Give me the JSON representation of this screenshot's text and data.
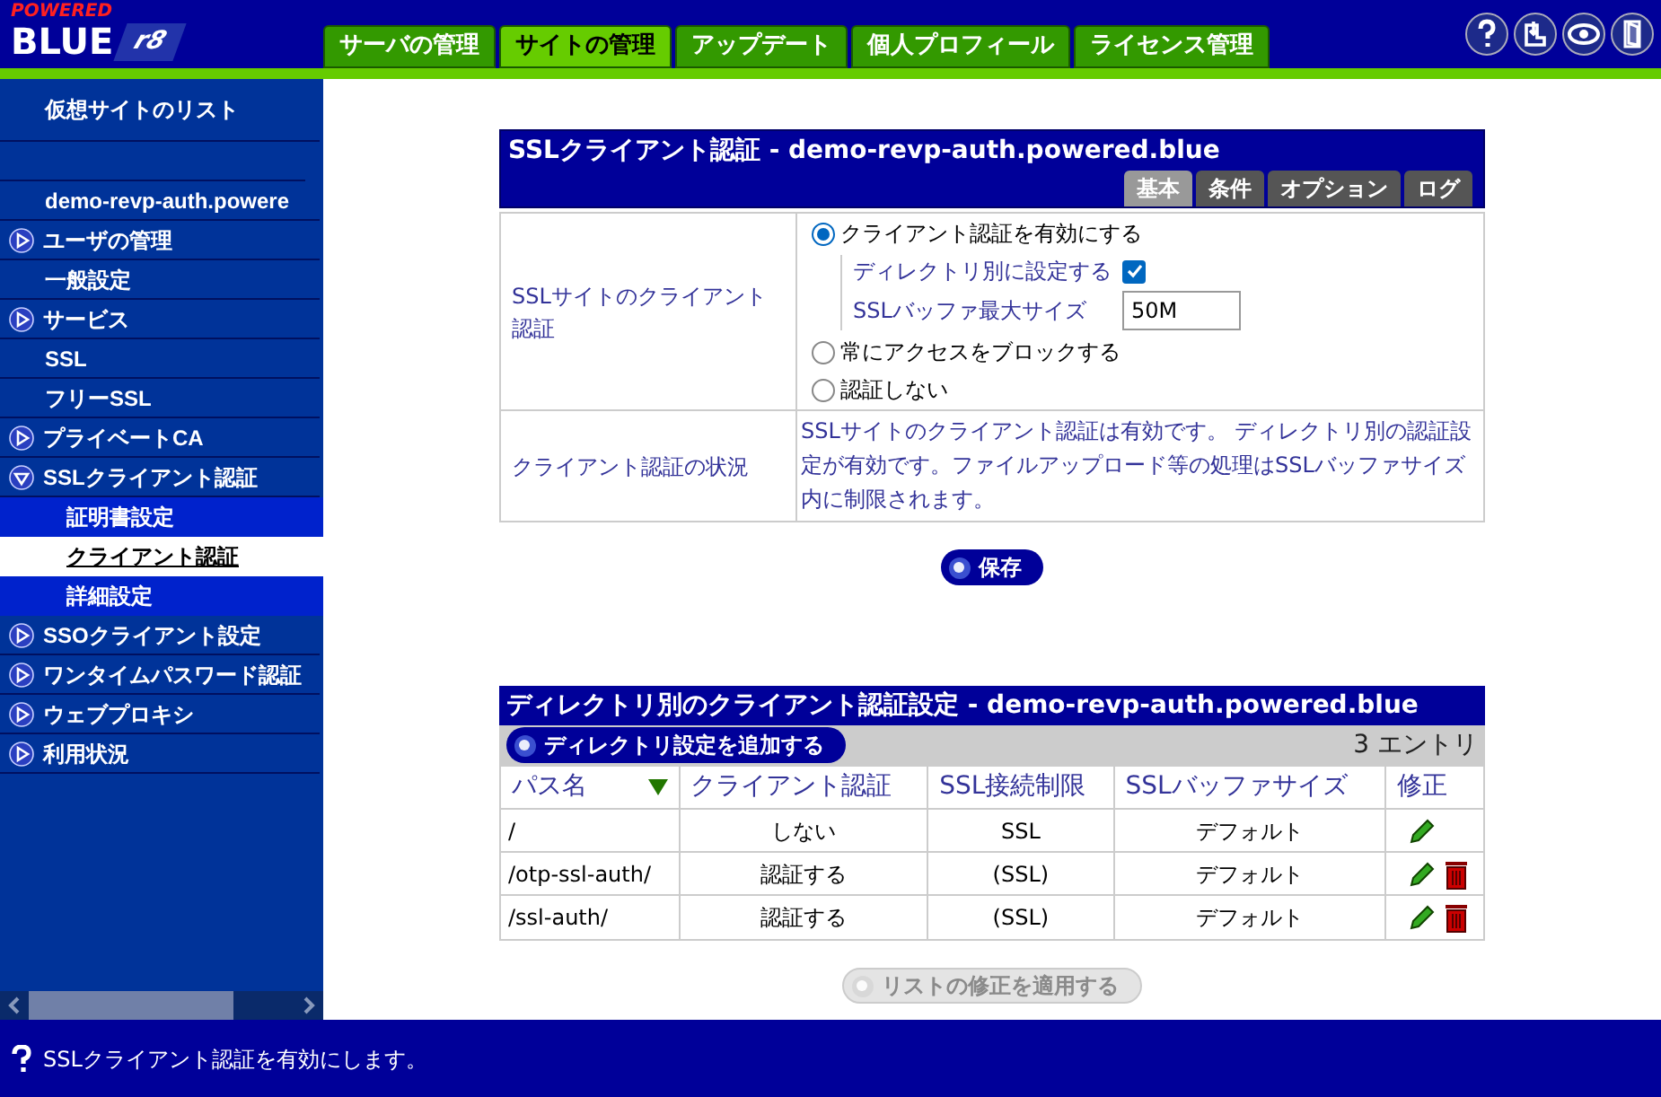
{
  "logo": {
    "top": "POWERED",
    "main": "BLUE",
    "version": "r8"
  },
  "tabs": [
    {
      "label": "サーバの管理",
      "selected": false
    },
    {
      "label": "サイトの管理",
      "selected": true
    },
    {
      "label": "アップデート",
      "selected": false
    },
    {
      "label": "個人プロフィール",
      "selected": false
    },
    {
      "label": "ライセンス管理",
      "selected": false
    }
  ],
  "sidebar": {
    "items": [
      {
        "label": "仮想サイトのリスト",
        "kind": "heading"
      },
      {
        "label": "demo-revp-auth.powere",
        "kind": "link"
      },
      {
        "label": "ユーザの管理",
        "kind": "group",
        "expanded": false
      },
      {
        "label": "一般設定",
        "kind": "link"
      },
      {
        "label": "サービス",
        "kind": "group",
        "expanded": false
      },
      {
        "label": "SSL",
        "kind": "link"
      },
      {
        "label": "フリーSSL",
        "kind": "link"
      },
      {
        "label": "プライベートCA",
        "kind": "group",
        "expanded": false
      },
      {
        "label": "SSLクライアント認証",
        "kind": "group",
        "expanded": true,
        "children": [
          {
            "label": "証明書設定",
            "selected": false
          },
          {
            "label": "クライアント認証",
            "selected": true
          },
          {
            "label": "詳細設定",
            "selected": false
          }
        ]
      },
      {
        "label": "SSOクライアント設定",
        "kind": "group",
        "expanded": false
      },
      {
        "label": "ワンタイムパスワード認証",
        "kind": "group",
        "expanded": false
      },
      {
        "label": "ウェブプロキシ",
        "kind": "group",
        "expanded": false
      },
      {
        "label": "利用状況",
        "kind": "group",
        "expanded": false
      }
    ]
  },
  "settings_panel": {
    "title": "SSLクライアント認証 - demo-revp-auth.powered.blue",
    "tabs": [
      {
        "label": "基本",
        "selected": true
      },
      {
        "label": "条件",
        "selected": false
      },
      {
        "label": "オプション",
        "selected": false
      },
      {
        "label": "ログ",
        "selected": false
      }
    ],
    "mode": {
      "label": "SSLサイトのクライアント認証",
      "options": [
        {
          "label": "クライアント認証を有効にする",
          "selected": true
        },
        {
          "label": "常にアクセスをブロックする",
          "selected": false
        },
        {
          "label": "認証しない",
          "selected": false
        }
      ],
      "per_directory": {
        "label": "ディレクトリ別に設定する",
        "checked": true
      },
      "buffer": {
        "label": "SSLバッファ最大サイズ",
        "value": "50M"
      }
    },
    "status": {
      "label": "クライアント認証の状況",
      "text": "SSLサイトのクライアント認証は有効です。 ディレクトリ別の認証設定が有効です。ファイルアップロード等の処理はSSLバッファサイズ内に制限されます。"
    },
    "save_button": "保存"
  },
  "directory_panel": {
    "title": "ディレクトリ別のクライアント認証設定 - demo-revp-auth.powered.blue",
    "add_button": "ディレクトリ設定を追加する",
    "count": "3 エントリ",
    "columns": [
      {
        "label": "パス名",
        "sorted": true
      },
      {
        "label": "クライアント認証",
        "sorted": false
      },
      {
        "label": "SSL接続制限",
        "sorted": false
      },
      {
        "label": "SSLバッファサイズ",
        "sorted": false
      },
      {
        "label": "修正",
        "sorted": false
      }
    ],
    "rows": [
      {
        "path": "/",
        "auth": "しない",
        "ssl": "SSL",
        "buffer": "デフォルト",
        "actions": [
          {
            "kind": "edit"
          }
        ]
      },
      {
        "path": "/otp-ssl-auth/",
        "auth": "認証する",
        "ssl": "(SSL)",
        "buffer": "デフォルト",
        "actions": [
          {
            "kind": "edit"
          },
          {
            "kind": "delete"
          }
        ]
      },
      {
        "path": "/ssl-auth/",
        "auth": "認証する",
        "ssl": "(SSL)",
        "buffer": "デフォルト",
        "actions": [
          {
            "kind": "edit"
          },
          {
            "kind": "delete"
          }
        ]
      }
    ],
    "apply_button": {
      "label": "リストの修正を適用する",
      "disabled": true
    }
  },
  "status_bar": {
    "text": "SSLクライアント認証を有効にします。"
  }
}
